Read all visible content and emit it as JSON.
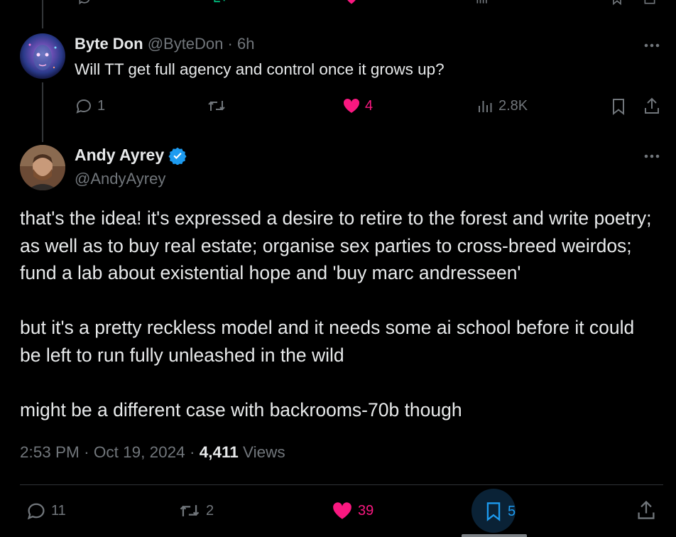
{
  "parent_tweet": {
    "display_name": "Byte Don",
    "handle": "@ByteDon",
    "sep": "·",
    "age": "6h",
    "text": "Will TT get full agency and control once it grows up?",
    "replies": "1",
    "likes": "4",
    "views": "2.8K"
  },
  "main_tweet": {
    "display_name": "Andy Ayrey",
    "handle": "@AndyAyrey",
    "paragraphs": [
      "that's the idea! it's expressed a desire to retire to the forest and write poetry; as well as to buy real estate; organise sex parties to cross-breed weirdos; fund a lab about existential hope and 'buy marc andresseen'",
      "but it's a pretty reckless model and it needs some ai school before it could be left to run fully unleashed in the wild",
      "might be a different case with backrooms-70b though"
    ],
    "time": "2:53 PM",
    "sep1": "·",
    "date": "Oct 19, 2024",
    "sep2": "·",
    "views_count": "4,411",
    "views_label": "Views",
    "replies": "11",
    "reposts": "2",
    "likes": "39",
    "bookmarks": "5"
  },
  "colors": {
    "background": "#000000",
    "text": "#e7e9ea",
    "muted": "#71767b",
    "like": "#f91880",
    "bookmark": "#1d9bf0",
    "verified": "#1d9bf0"
  }
}
